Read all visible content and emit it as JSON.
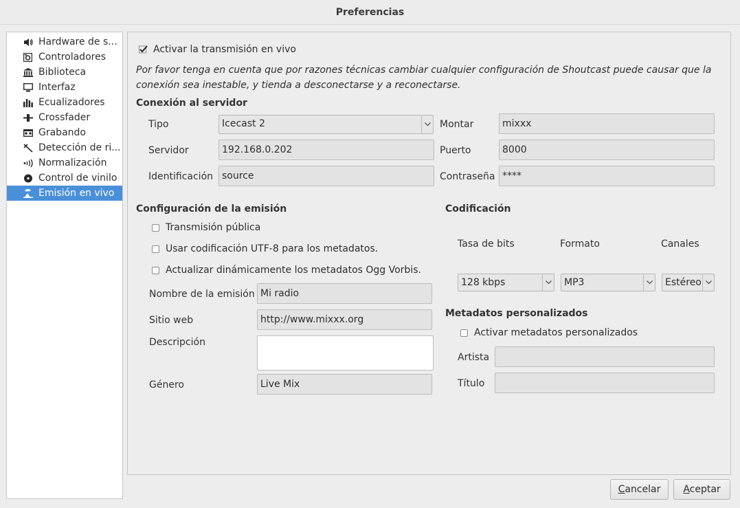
{
  "window": {
    "title": "Preferencias"
  },
  "sidebar": {
    "items": [
      {
        "label": "Hardware de s...",
        "icon": "speaker-icon"
      },
      {
        "label": "Controladores",
        "icon": "controller-icon"
      },
      {
        "label": "Biblioteca",
        "icon": "library-icon"
      },
      {
        "label": "Interfaz",
        "icon": "monitor-icon"
      },
      {
        "label": "Ecualizadores",
        "icon": "equalizer-icon"
      },
      {
        "label": "Crossfader",
        "icon": "crossfader-icon"
      },
      {
        "label": "Grabando",
        "icon": "recording-icon"
      },
      {
        "label": "Detección de ri...",
        "icon": "beat-detection-icon"
      },
      {
        "label": "Normalización",
        "icon": "normalization-icon"
      },
      {
        "label": "Control de vinilo",
        "icon": "vinyl-icon"
      },
      {
        "label": "Emisión en vivo",
        "icon": "broadcast-icon"
      }
    ],
    "selected": "Emisión en vivo",
    "selected_color": "#4a90d9"
  },
  "live": {
    "enable_label": "Activar la transmisión en vivo",
    "enable_checked": true,
    "note": "Por favor tenga en cuenta que por razones técnicas cambiar cualquier configuración de Shoutcast puede causar que la conexión sea inestable, y tienda a desconectarse y a reconectarse."
  },
  "server": {
    "heading": "Conexión al servidor",
    "type_label": "Tipo",
    "type_value": "Icecast 2",
    "mount_label": "Montar",
    "mount_value": "mixxx",
    "host_label": "Servidor",
    "host_value": "192.168.0.202",
    "port_label": "Puerto",
    "port_value": "8000",
    "login_label": "Identificación",
    "login_value": "source",
    "password_label": "Contraseña",
    "password_value": "****"
  },
  "stream": {
    "heading": "Configuración de la emisión",
    "public_label": "Transmisión pública",
    "public_checked": false,
    "utf8_label": "Usar codificación UTF-8 para los metadatos.",
    "utf8_checked": false,
    "ogg_label": "Actualizar dinámicamente los metadatos Ogg Vorbis.",
    "ogg_checked": false,
    "name_label": "Nombre de la emisión",
    "name_value": "Mi radio",
    "website_label": "Sitio web",
    "website_value": "http://www.mixxx.org",
    "description_label": "Descripción",
    "description_value": "",
    "genre_label": "Género",
    "genre_value": "Live Mix"
  },
  "encoding": {
    "heading": "Codificación",
    "bitrate_label": "Tasa de bits",
    "bitrate_value": "128 kbps",
    "format_label": "Formato",
    "format_value": "MP3",
    "channels_label": "Canales",
    "channels_value": "Estéreo"
  },
  "metadata": {
    "heading": "Metadatos personalizados",
    "enable_label": "Activar metadatos personalizados",
    "enable_checked": false,
    "artist_label": "Artista",
    "artist_value": "",
    "title_label": "Título",
    "title_value": ""
  },
  "buttons": {
    "cancel_first": "C",
    "cancel_rest": "ancelar",
    "accept_first": "A",
    "accept_rest": "ceptar"
  }
}
